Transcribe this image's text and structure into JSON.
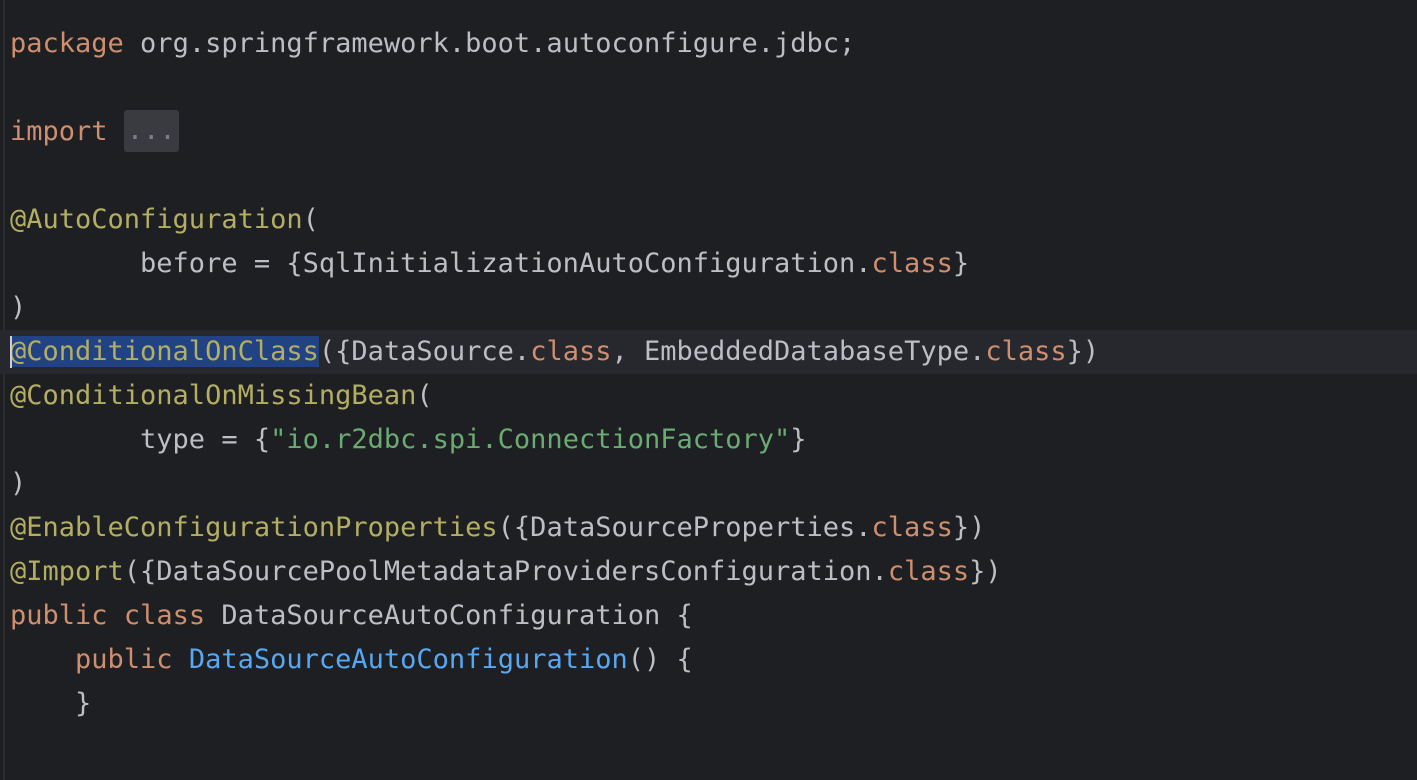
{
  "editor": {
    "lines": [
      {
        "tokens": [
          {
            "t": "package",
            "c": "kw"
          },
          {
            "t": " org.springframework.boot.autoconfigure.jdbc;",
            "c": "plain"
          }
        ]
      },
      {
        "tokens": []
      },
      {
        "tokens": [
          {
            "t": "import",
            "c": "kw"
          },
          {
            "t": " ",
            "c": "plain"
          },
          {
            "t": "...",
            "c": "fold"
          }
        ]
      },
      {
        "tokens": []
      },
      {
        "tokens": [
          {
            "t": "@AutoConfiguration",
            "c": "ann"
          },
          {
            "t": "(",
            "c": "plain"
          }
        ]
      },
      {
        "tokens": [
          {
            "t": "        before = {SqlInitializationAutoConfiguration.",
            "c": "plain"
          },
          {
            "t": "class",
            "c": "kw"
          },
          {
            "t": "}",
            "c": "plain"
          }
        ]
      },
      {
        "tokens": [
          {
            "t": ")",
            "c": "plain"
          }
        ]
      },
      {
        "current": true,
        "tokens": [
          {
            "t": "@ConditionalOnClass",
            "c": "ann sel"
          },
          {
            "t": "({DataSource.",
            "c": "plain"
          },
          {
            "t": "class",
            "c": "kw"
          },
          {
            "t": ", EmbeddedDatabaseType.",
            "c": "plain"
          },
          {
            "t": "class",
            "c": "kw"
          },
          {
            "t": "})",
            "c": "plain"
          }
        ]
      },
      {
        "tokens": [
          {
            "t": "@ConditionalOnMissingBean",
            "c": "ann"
          },
          {
            "t": "(",
            "c": "plain"
          }
        ]
      },
      {
        "tokens": [
          {
            "t": "        type = {",
            "c": "plain"
          },
          {
            "t": "\"io.r2dbc.spi.ConnectionFactory\"",
            "c": "str"
          },
          {
            "t": "}",
            "c": "plain"
          }
        ]
      },
      {
        "tokens": [
          {
            "t": ")",
            "c": "plain"
          }
        ]
      },
      {
        "tokens": [
          {
            "t": "@EnableConfigurationProperties",
            "c": "ann"
          },
          {
            "t": "({DataSourceProperties.",
            "c": "plain"
          },
          {
            "t": "class",
            "c": "kw"
          },
          {
            "t": "})",
            "c": "plain"
          }
        ]
      },
      {
        "tokens": [
          {
            "t": "@Import",
            "c": "ann"
          },
          {
            "t": "({DataSourcePoolMetadataProvidersConfiguration.",
            "c": "plain"
          },
          {
            "t": "class",
            "c": "kw"
          },
          {
            "t": "})",
            "c": "plain"
          }
        ]
      },
      {
        "tokens": [
          {
            "t": "public",
            "c": "kw"
          },
          {
            "t": " ",
            "c": "plain"
          },
          {
            "t": "class",
            "c": "kw"
          },
          {
            "t": " DataSourceAutoConfiguration {",
            "c": "plain"
          }
        ]
      },
      {
        "tokens": [
          {
            "t": "    ",
            "c": "plain"
          },
          {
            "t": "public",
            "c": "kw"
          },
          {
            "t": " ",
            "c": "plain"
          },
          {
            "t": "DataSourceAutoConfiguration",
            "c": "fn"
          },
          {
            "t": "() {",
            "c": "plain"
          }
        ]
      },
      {
        "tokens": [
          {
            "t": "    }",
            "c": "plain"
          }
        ]
      }
    ]
  }
}
